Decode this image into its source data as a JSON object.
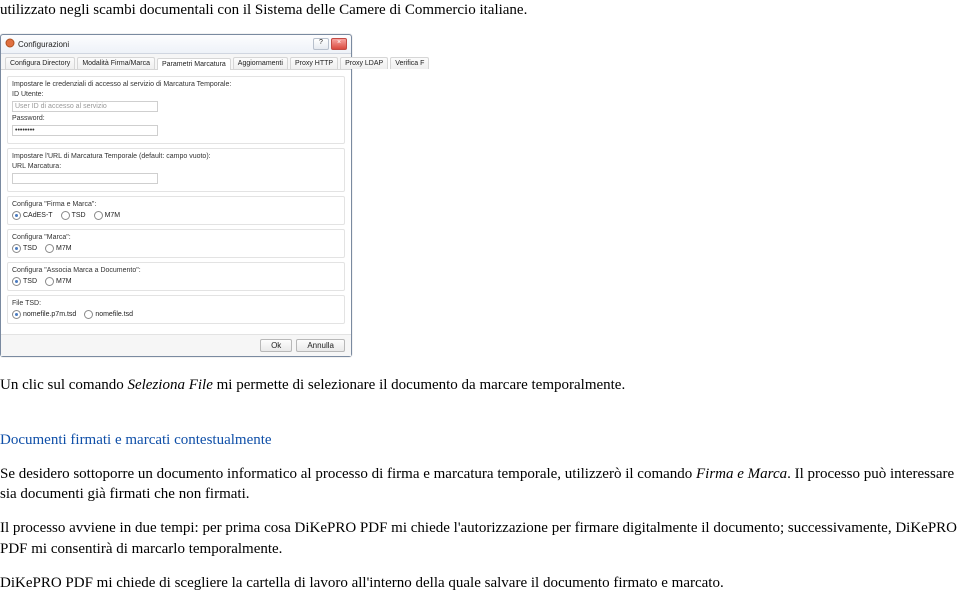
{
  "intro": "utilizzato negli scambi documentali con il Sistema delle Camere di Commercio italiane.",
  "dialog": {
    "title": "Configurazioni",
    "tabs": [
      "Configura Directory",
      "Modalità Firma/Marca",
      "Parametri Marcatura",
      "Aggiornamenti",
      "Proxy HTTP",
      "Proxy LDAP",
      "Verifica F"
    ],
    "section1": {
      "title": "Impostare le credenziali di accesso al servizio di Marcatura Temporale:",
      "id_label": "ID Utente:",
      "id_hint": "User ID di accesso al servizio",
      "pwd_label": "Password:",
      "pwd_value": "••••••••"
    },
    "section2": {
      "title": "Impostare l'URL di Marcatura Temporale (default: campo vuoto):",
      "url_label": "URL Marcatura:"
    },
    "section3": {
      "title": "Configura \"Firma e Marca\":",
      "options": [
        "CAdES-T",
        "TSD",
        "M7M"
      ]
    },
    "section4": {
      "title": "Configura \"Marca\":",
      "options": [
        "TSD",
        "M7M"
      ]
    },
    "section5": {
      "title": "Configura \"Associa Marca a Documento\":",
      "options": [
        "TSD",
        "M7M"
      ]
    },
    "section6": {
      "title": "File TSD:",
      "options": [
        "nomefile.p7m.tsd",
        "nomefile.tsd"
      ]
    },
    "ok": "Ok",
    "cancel": "Annulla"
  },
  "after_dialog_pre": "Un clic sul comando ",
  "after_dialog_italic": "Seleziona File",
  "after_dialog_post": " mi permette di selezionare il documento da marcare temporalmente.",
  "heading": "Documenti firmati e marcati contestualmente",
  "p1_a": "Se desidero sottoporre un documento informatico al processo di firma e marcatura temporale, utilizzerò il comando ",
  "p1_i": "Firma e Marca",
  "p1_b": ". Il processo può interessare sia documenti già firmati che non firmati.",
  "p2": "Il processo avviene in due tempi: per prima cosa DiKePRO PDF mi chiede l'autorizzazione per firmare digitalmente il documento; successivamente, DiKePRO PDF mi consentirà di marcarlo temporalmente.",
  "p3": "DiKePRO PDF mi chiede di scegliere la cartella di lavoro all'interno della quale salvare il documento firmato e marcato."
}
